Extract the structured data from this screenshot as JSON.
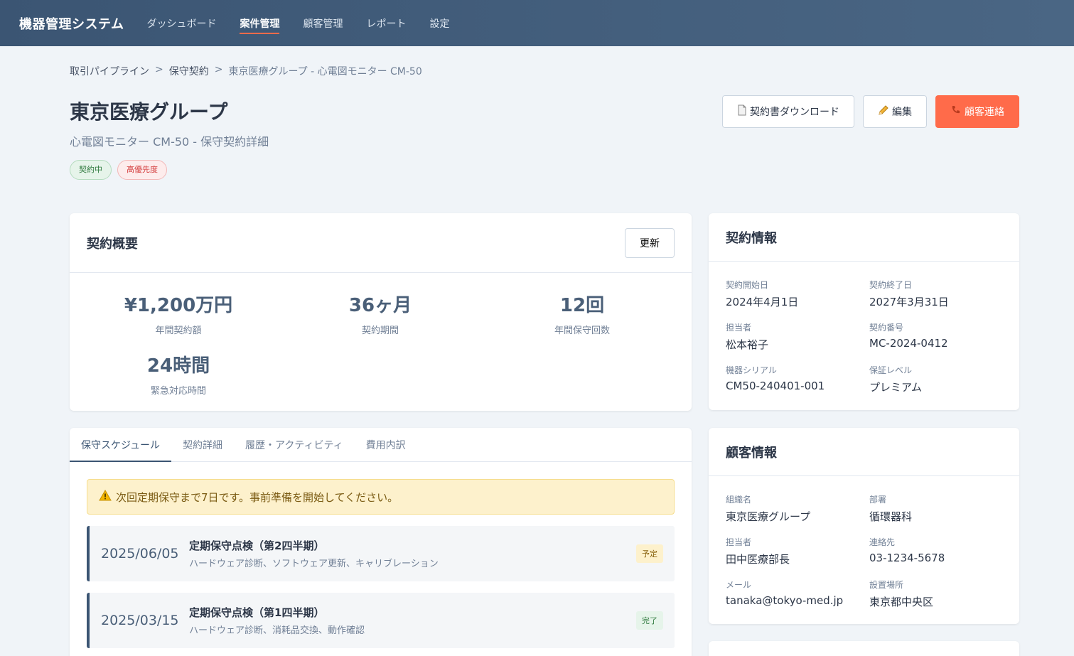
{
  "app": {
    "brand": "機器管理システム"
  },
  "nav": {
    "items": [
      {
        "label": "ダッシュボード"
      },
      {
        "label": "案件管理"
      },
      {
        "label": "顧客管理"
      },
      {
        "label": "レポート"
      },
      {
        "label": "設定"
      }
    ],
    "active": "案件管理"
  },
  "breadcrumb": {
    "items": [
      "取引パイプライン",
      "保守契約",
      "東京医療グループ - 心電図モニター CM-50"
    ],
    "separator": ">"
  },
  "header": {
    "title": "東京医療グループ",
    "subtitle": "心電図モニター CM-50 - 保守契約詳細",
    "badges": [
      {
        "label": "契約中",
        "tone": "green"
      },
      {
        "label": "高優先度",
        "tone": "red"
      }
    ],
    "actions": {
      "download": {
        "icon": "document-icon",
        "label": "契約書ダウンロード"
      },
      "edit": {
        "icon": "pencil-icon",
        "label": "編集"
      },
      "contact": {
        "icon": "phone-icon",
        "label": "顧客連絡"
      }
    }
  },
  "summary": {
    "title": "契約概要",
    "refresh_label": "更新",
    "stats": [
      {
        "value": "¥1,200万円",
        "label": "年間契約額"
      },
      {
        "value": "36ヶ月",
        "label": "契約期間"
      },
      {
        "value": "12回",
        "label": "年間保守回数"
      },
      {
        "value": "24時間",
        "label": "緊急対応時間"
      }
    ]
  },
  "contract_info": {
    "title": "契約情報",
    "fields": [
      {
        "label": "契約開始日",
        "value": "2024年4月1日"
      },
      {
        "label": "契約終了日",
        "value": "2027年3月31日"
      },
      {
        "label": "担当者",
        "value": "松本裕子"
      },
      {
        "label": "契約番号",
        "value": "MC-2024-0412"
      },
      {
        "label": "機器シリアル",
        "value": "CM50-240401-001"
      },
      {
        "label": "保証レベル",
        "value": "プレミアム"
      }
    ]
  },
  "customer_info": {
    "title": "顧客情報",
    "fields": [
      {
        "label": "組織名",
        "value": "東京医療グループ"
      },
      {
        "label": "部署",
        "value": "循環器科"
      },
      {
        "label": "担当者",
        "value": "田中医療部長"
      },
      {
        "label": "連絡先",
        "value": "03-1234-5678"
      },
      {
        "label": "メール",
        "value": "tanaka@tokyo-med.jp"
      },
      {
        "label": "設置場所",
        "value": "東京都中央区"
      }
    ]
  },
  "tabs": {
    "items": [
      {
        "label": "保守スケジュール"
      },
      {
        "label": "契約詳細"
      },
      {
        "label": "履歴・アクティビティ"
      },
      {
        "label": "費用内訳"
      }
    ],
    "active": "保守スケジュール"
  },
  "schedule": {
    "alert": {
      "icon": "warning-icon",
      "text": "次回定期保守まで7日です。事前準備を開始してください。"
    },
    "items": [
      {
        "date": "2025/06/05",
        "title": "定期保守点検（第2四半期）",
        "detail": "ハードウェア診断、ソフトウェア更新、キャリブレーション",
        "status": "予定"
      },
      {
        "date": "2025/03/15",
        "title": "定期保守点検（第1四半期）",
        "detail": "ハードウェア診断、消耗品交換、動作確認",
        "status": "完了"
      }
    ]
  },
  "colors": {
    "nav": "#3b5573",
    "accent": "#ff6b4a",
    "success": "#2f7a3e",
    "danger": "#d33a3a",
    "warning": "#fdf1cc"
  }
}
